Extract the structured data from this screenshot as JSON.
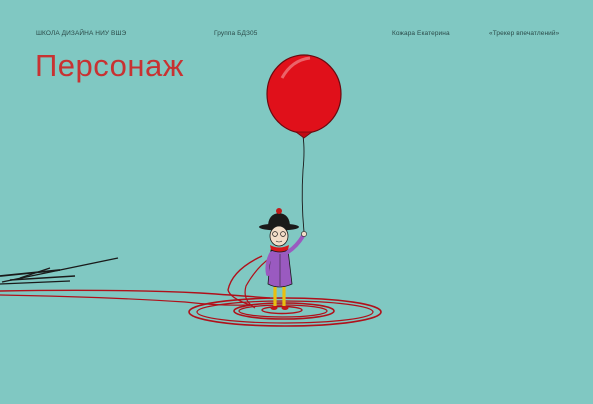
{
  "header": {
    "school": "ШКОЛА ДИЗАЙНА НИУ ВШЭ",
    "group": "Группа БДЗ05",
    "author": "Кожара Екатерина",
    "project": "«Трекер впечатлений»"
  },
  "title": "Персонаж",
  "colors": {
    "background": "#80c8c2",
    "accent": "#c83232",
    "balloon": "#e0101a",
    "string": "#b0101a"
  },
  "illustration": {
    "subject": "character-holding-red-balloon",
    "icons": [
      "balloon-icon",
      "character-icon",
      "string-spiral-icon",
      "shadow-icon"
    ]
  }
}
